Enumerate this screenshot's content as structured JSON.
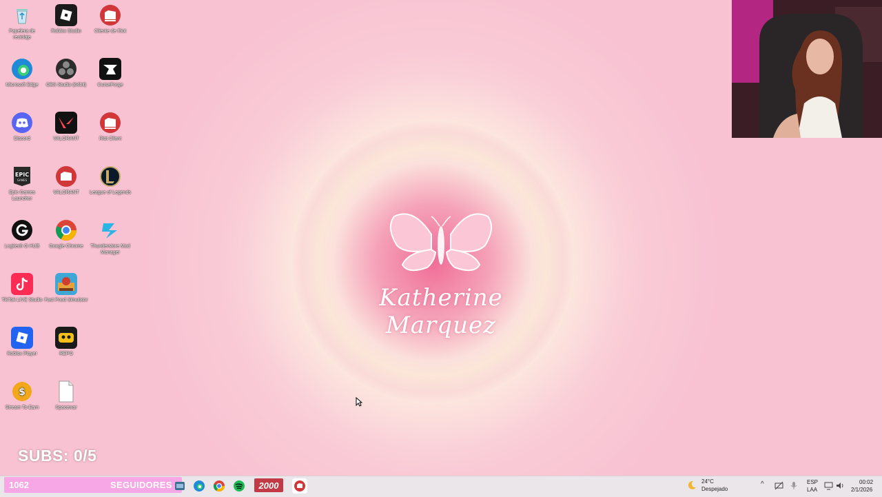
{
  "desktop": {
    "icons": [
      {
        "label": "Papelera de reciclaje",
        "icon": "recycle-bin-icon"
      },
      {
        "label": "Roblox Studio",
        "icon": "roblox-studio-icon"
      },
      {
        "label": "Cliente de Riot",
        "icon": "riot-client-icon"
      },
      {
        "label": "Microsoft Edge",
        "icon": "edge-icon"
      },
      {
        "label": "OBS Studio (64bit)",
        "icon": "obs-icon"
      },
      {
        "label": "CurseForge",
        "icon": "curseforge-icon"
      },
      {
        "label": "Discord",
        "icon": "discord-icon"
      },
      {
        "label": "VALORANT",
        "icon": "valorant-icon"
      },
      {
        "label": "Riot Client",
        "icon": "riot-client-icon"
      },
      {
        "label": "Epic Games Launcher",
        "icon": "epic-games-icon"
      },
      {
        "label": "VALORANT",
        "icon": "riot-valorant-icon"
      },
      {
        "label": "League of Legends",
        "icon": "league-icon"
      },
      {
        "label": "Logitech G HUB",
        "icon": "logitech-icon"
      },
      {
        "label": "Google Chrome",
        "icon": "chrome-icon"
      },
      {
        "label": "Thunderstore Mod Manager",
        "icon": "thunderstore-icon"
      },
      {
        "label": "TikTok LIVE Studio",
        "icon": "tiktok-icon"
      },
      {
        "label": "Fast Food Simulator",
        "icon": "fast-food-sim-icon"
      },
      {
        "label": "Roblox Player",
        "icon": "roblox-player-icon"
      },
      {
        "label": "REPO",
        "icon": "repo-game-icon"
      },
      {
        "label": "Stream To Earn",
        "icon": "stream-to-earn-icon"
      },
      {
        "label": "Spacewar",
        "icon": "file-icon"
      }
    ]
  },
  "wallpaper": {
    "name": "Katherine Marquez",
    "logo_icon": "butterfly-icon"
  },
  "overlay": {
    "subs_text": "SUBS: 0/5",
    "followers_count": "1062",
    "followers_label": "SEGUIDORES",
    "goal_value": "2000"
  },
  "taskbar": {
    "weather_temp": "24°C",
    "weather_desc": "Despejado",
    "lang_top": "ESP",
    "lang_bottom": "LAA",
    "time": "00:02",
    "date": "2/1/2026"
  },
  "colors": {
    "accent_pink": "#f7a6e6",
    "riot_red": "#d13639",
    "taskbar_bg": "#ebe6ea"
  }
}
